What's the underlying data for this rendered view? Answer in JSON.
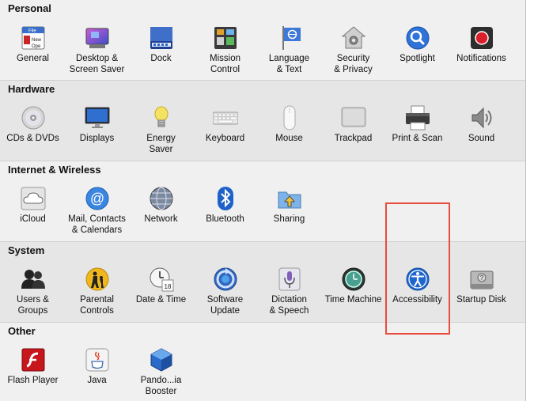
{
  "colors": {
    "highlight": "#e74c3c",
    "accent_blue": "#2f72d8"
  },
  "sections": [
    {
      "title": "Personal",
      "items": [
        {
          "label": "General",
          "icon": "general-icon"
        },
        {
          "label": "Desktop &\nScreen Saver",
          "icon": "desktop-screensaver-icon"
        },
        {
          "label": "Dock",
          "icon": "dock-icon"
        },
        {
          "label": "Mission\nControl",
          "icon": "mission-control-icon"
        },
        {
          "label": "Language\n& Text",
          "icon": "language-text-icon"
        },
        {
          "label": "Security\n& Privacy",
          "icon": "security-privacy-icon"
        },
        {
          "label": "Spotlight",
          "icon": "spotlight-icon"
        },
        {
          "label": "Notifications",
          "icon": "notifications-icon"
        }
      ]
    },
    {
      "title": "Hardware",
      "items": [
        {
          "label": "CDs & DVDs",
          "icon": "cds-dvds-icon"
        },
        {
          "label": "Displays",
          "icon": "displays-icon"
        },
        {
          "label": "Energy\nSaver",
          "icon": "energy-saver-icon"
        },
        {
          "label": "Keyboard",
          "icon": "keyboard-icon"
        },
        {
          "label": "Mouse",
          "icon": "mouse-icon"
        },
        {
          "label": "Trackpad",
          "icon": "trackpad-icon"
        },
        {
          "label": "Print & Scan",
          "icon": "printer-icon"
        },
        {
          "label": "Sound",
          "icon": "sound-icon"
        }
      ]
    },
    {
      "title": "Internet & Wireless",
      "items": [
        {
          "label": "iCloud",
          "icon": "icloud-icon"
        },
        {
          "label": "Mail, Contacts\n& Calendars",
          "icon": "mail-contacts-icon"
        },
        {
          "label": "Network",
          "icon": "network-icon"
        },
        {
          "label": "Bluetooth",
          "icon": "bluetooth-icon"
        },
        {
          "label": "Sharing",
          "icon": "sharing-icon"
        }
      ]
    },
    {
      "title": "System",
      "items": [
        {
          "label": "Users &\nGroups",
          "icon": "users-groups-icon"
        },
        {
          "label": "Parental\nControls",
          "icon": "parental-controls-icon"
        },
        {
          "label": "Date & Time",
          "icon": "date-time-icon"
        },
        {
          "label": "Software\nUpdate",
          "icon": "software-update-icon"
        },
        {
          "label": "Dictation\n& Speech",
          "icon": "dictation-speech-icon"
        },
        {
          "label": "Time Machine",
          "icon": "time-machine-icon"
        },
        {
          "label": "Accessibility",
          "icon": "accessibility-icon"
        },
        {
          "label": "Startup Disk",
          "icon": "startup-disk-icon"
        }
      ]
    },
    {
      "title": "Other",
      "items": [
        {
          "label": "Flash Player",
          "icon": "flash-player-icon"
        },
        {
          "label": "Java",
          "icon": "java-icon"
        },
        {
          "label": "Pando...ia Booster",
          "icon": "pando-booster-icon"
        }
      ]
    }
  ]
}
